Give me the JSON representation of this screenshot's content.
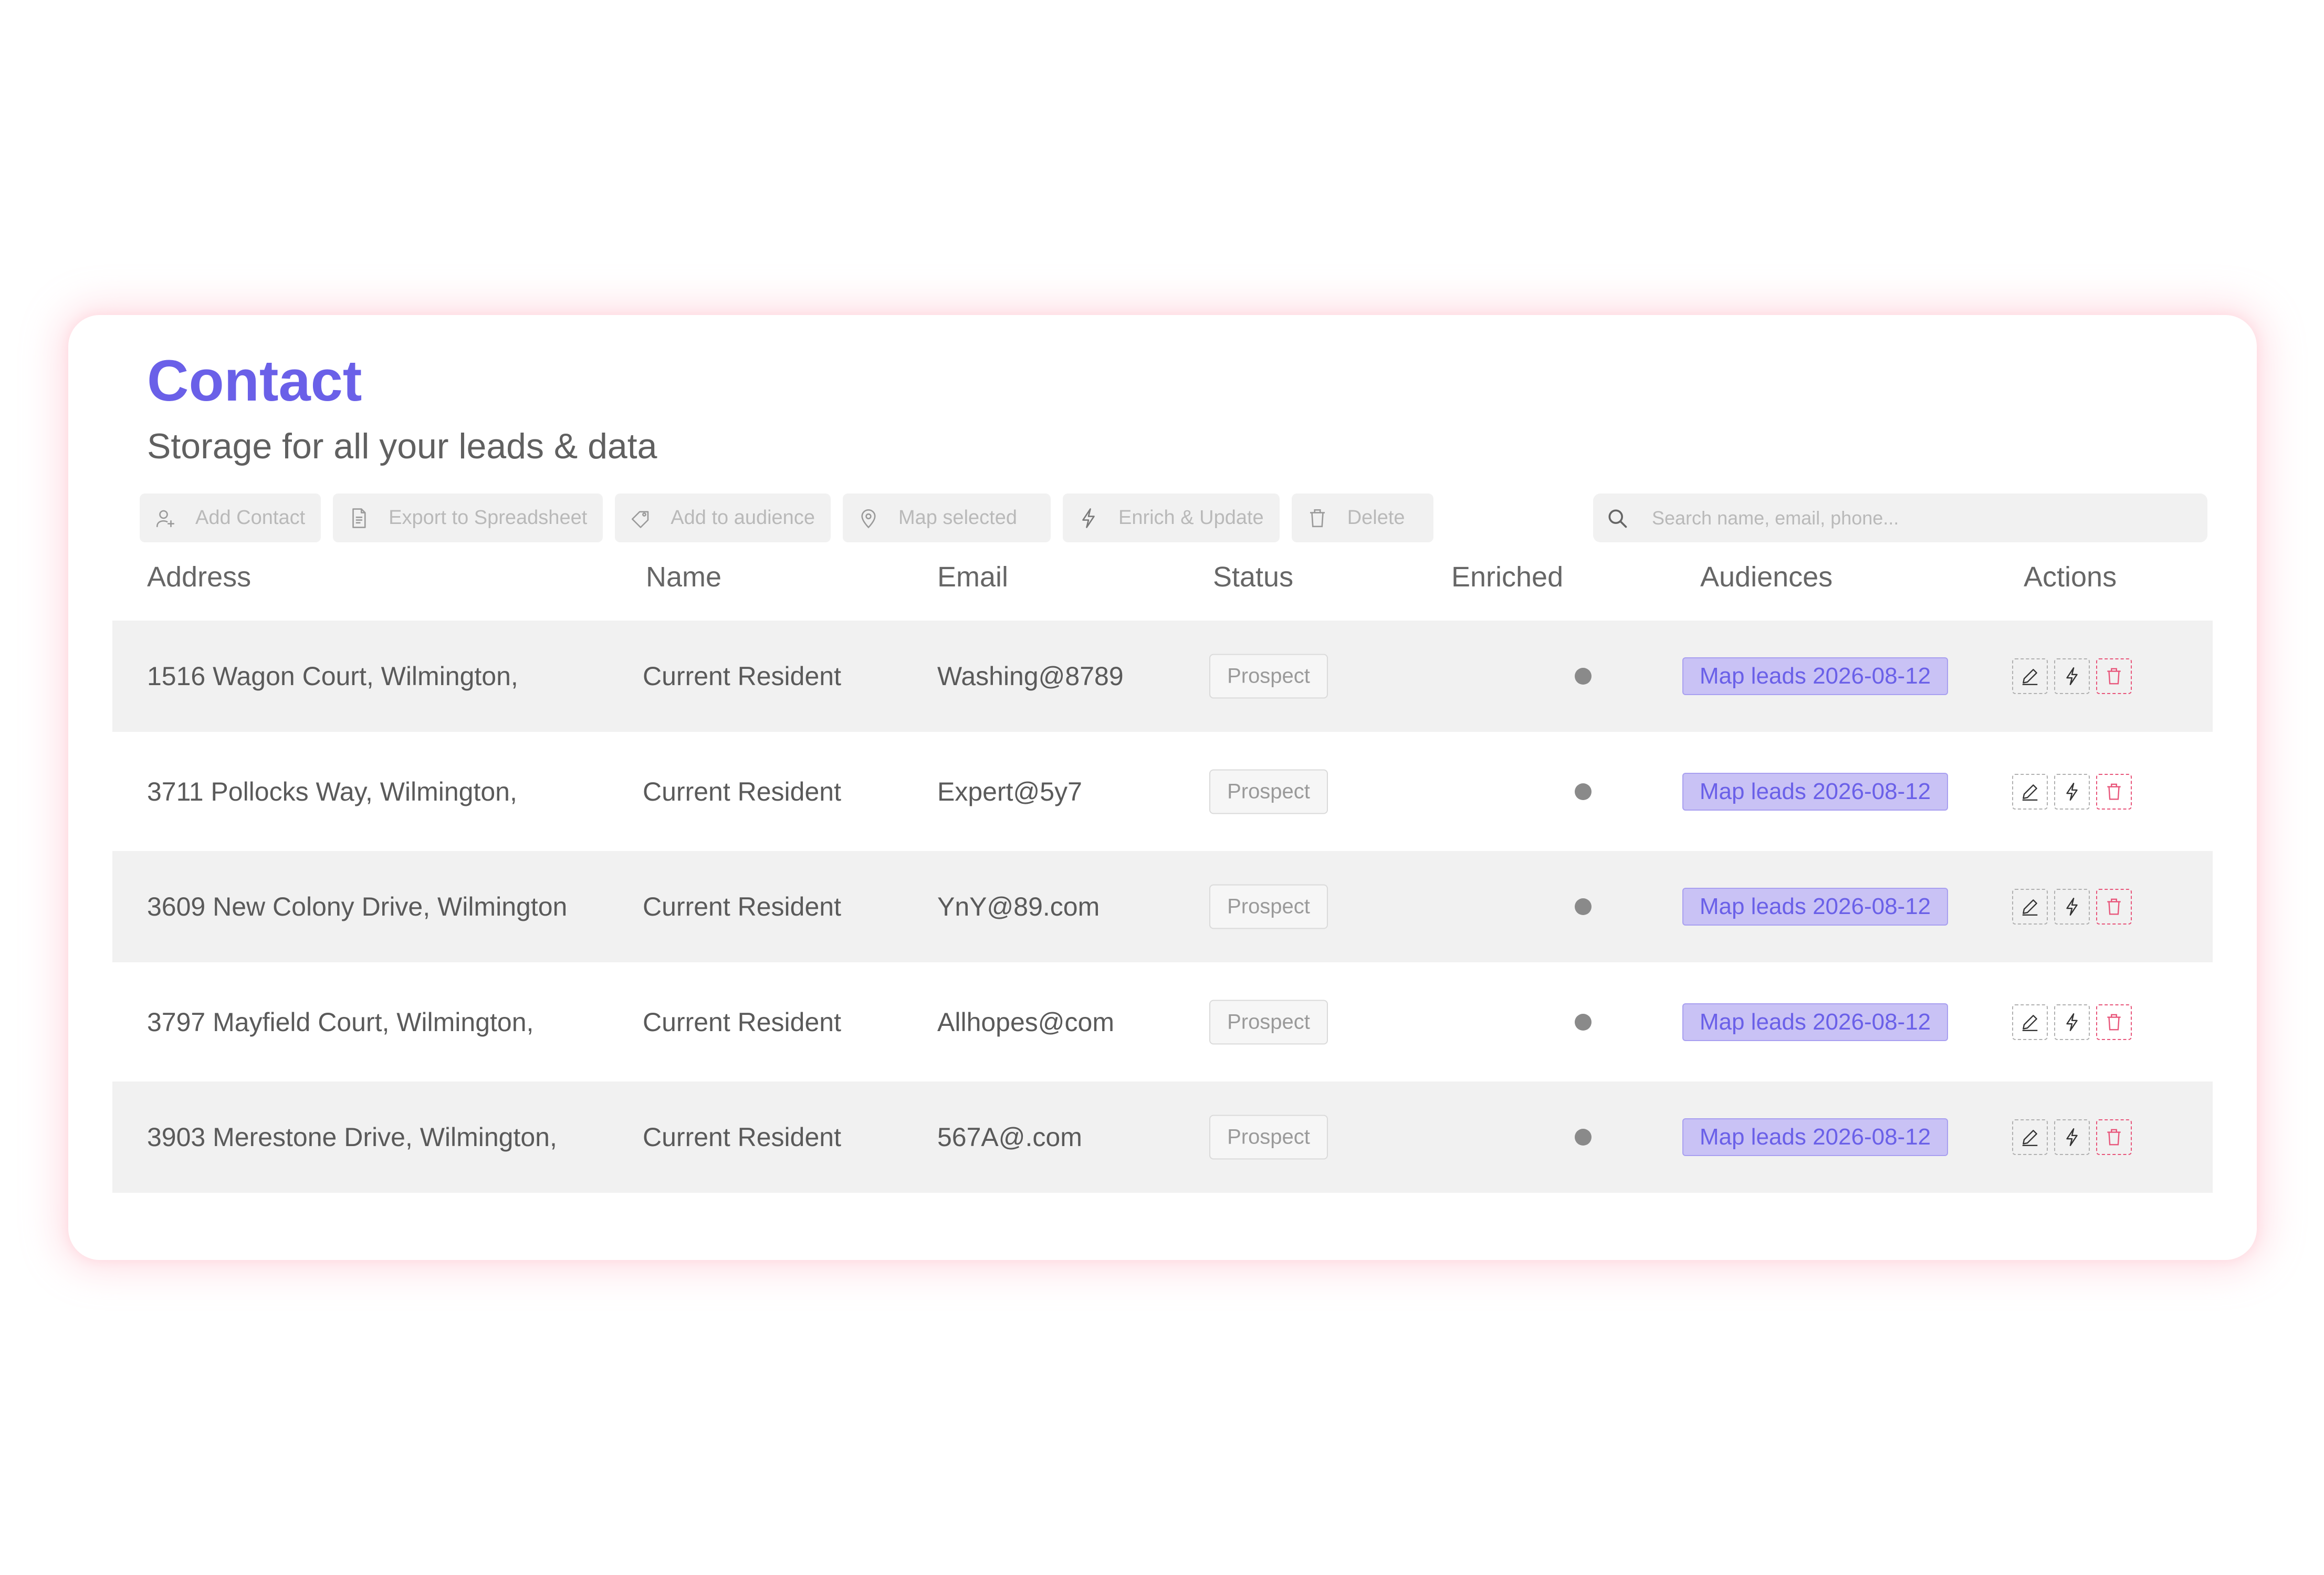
{
  "page": {
    "title": "Contact",
    "subtitle": "Storage for all your leads & data"
  },
  "toolbar": {
    "buttons": [
      {
        "label": "Add Contact",
        "icon": "user-add-icon"
      },
      {
        "label": "Export to Spreadsheet",
        "icon": "document-icon"
      },
      {
        "label": "Add to audience",
        "icon": "tag-icon"
      },
      {
        "label": "Map selected",
        "icon": "map-pin-icon"
      },
      {
        "label": "Enrich & Update",
        "icon": "lightning-icon"
      },
      {
        "label": "Delete",
        "icon": "trash-icon"
      }
    ],
    "search": {
      "placeholder": "Search name, email, phone...",
      "icon": "search-icon",
      "value": ""
    }
  },
  "table": {
    "columns": [
      "Address",
      "Name",
      "Email",
      "Status",
      "Enriched",
      "Audiences",
      "Actions"
    ],
    "rows": [
      {
        "address": "1516 Wagon Court, Wilmington,",
        "name": "Current Resident",
        "email": "Washing@8789",
        "status": "Prospect",
        "audience": "Map leads 2026-08-12"
      },
      {
        "address": "3711 Pollocks Way, Wilmington,",
        "name": "Current Resident",
        "email": "Expert@5y7",
        "status": "Prospect",
        "audience": "Map leads 2026-08-12"
      },
      {
        "address": "3609 New Colony Drive, Wilmington",
        "name": "Current Resident",
        "email": "YnY@89.com",
        "status": "Prospect",
        "audience": "Map leads 2026-08-12"
      },
      {
        "address": "3797 Mayfield Court, Wilmington,",
        "name": "Current Resident",
        "email": "Allhopes@com",
        "status": "Prospect",
        "audience": "Map leads 2026-08-12"
      },
      {
        "address": "3903 Merestone Drive, Wilmington,",
        "name": "Current Resident",
        "email": "567A@.com",
        "status": "Prospect",
        "audience": "Map leads 2026-08-12"
      }
    ],
    "row_actions": [
      "edit-icon",
      "lightning-icon",
      "trash-icon"
    ]
  },
  "colors": {
    "accent": "#6a60e8",
    "audience_bg": "#c9c2f5",
    "row_shade": "#f1f1f1",
    "delete": "#e8557a",
    "card_glow": "#ffb0c0"
  }
}
